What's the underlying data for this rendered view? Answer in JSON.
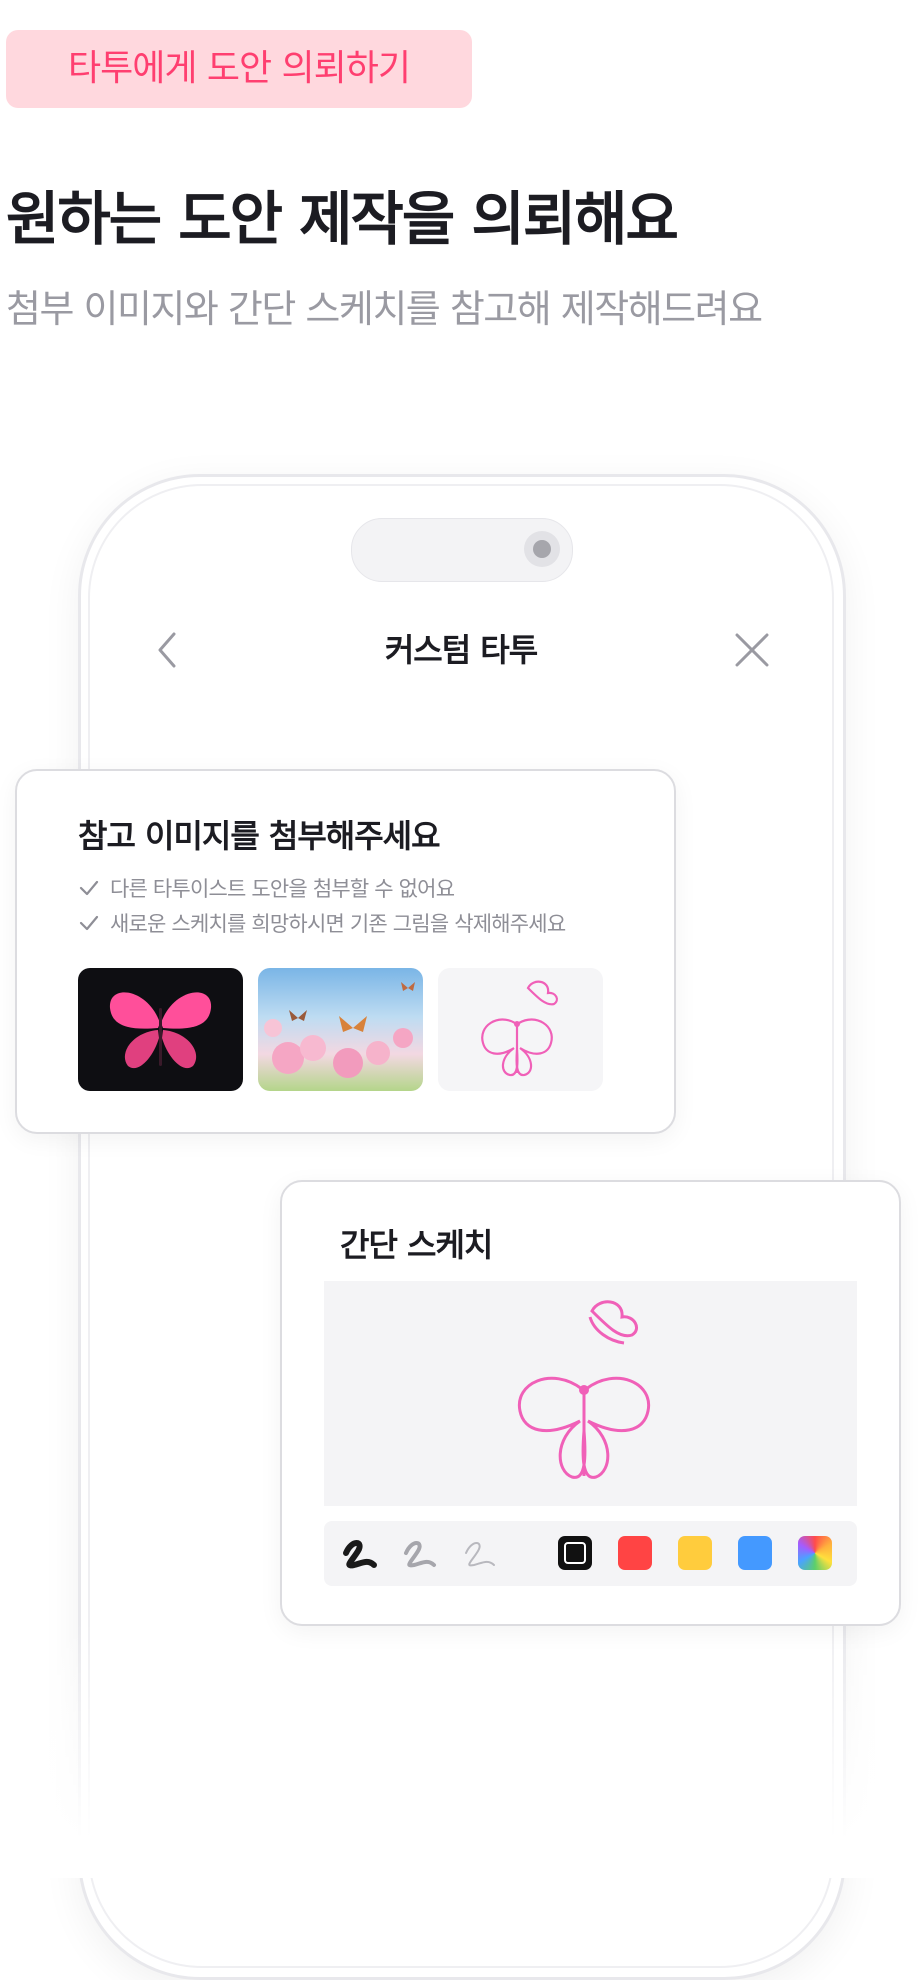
{
  "badge": "타투에게 도안 의뢰하기",
  "headline": "원하는 도안 제작을 의뢰해요",
  "subtitle": "첨부 이미지와 간단 스케치를 참고해 제작해드려요",
  "phone": {
    "nav_title": "커스텀 타투",
    "back_icon": "chevron-left-icon",
    "close_icon": "close-icon"
  },
  "reference_card": {
    "title": "참고 이미지를 첨부해주세요",
    "notes": [
      "다른 타투이스트 도안을 첨부할 수 없어요",
      "새로운 스케치를 희망하시면 기존 그림을 삭제해주세요"
    ],
    "thumbnails": [
      "pink-butterfly-photo",
      "butterflies-on-blossoms-photo",
      "butterfly-sketch"
    ]
  },
  "sketch_card": {
    "title": "간단 스케치",
    "brushes": [
      "brush-thick",
      "brush-medium",
      "brush-thin"
    ],
    "colors": [
      "#111111",
      "#ff4444",
      "#ffcc3d",
      "#4499ff",
      "rainbow"
    ],
    "selected_color": "#111111",
    "stroke_color": "#f060b8"
  },
  "colors": {
    "accent": "#ff3f70",
    "badge_bg": "#ffd8de"
  }
}
